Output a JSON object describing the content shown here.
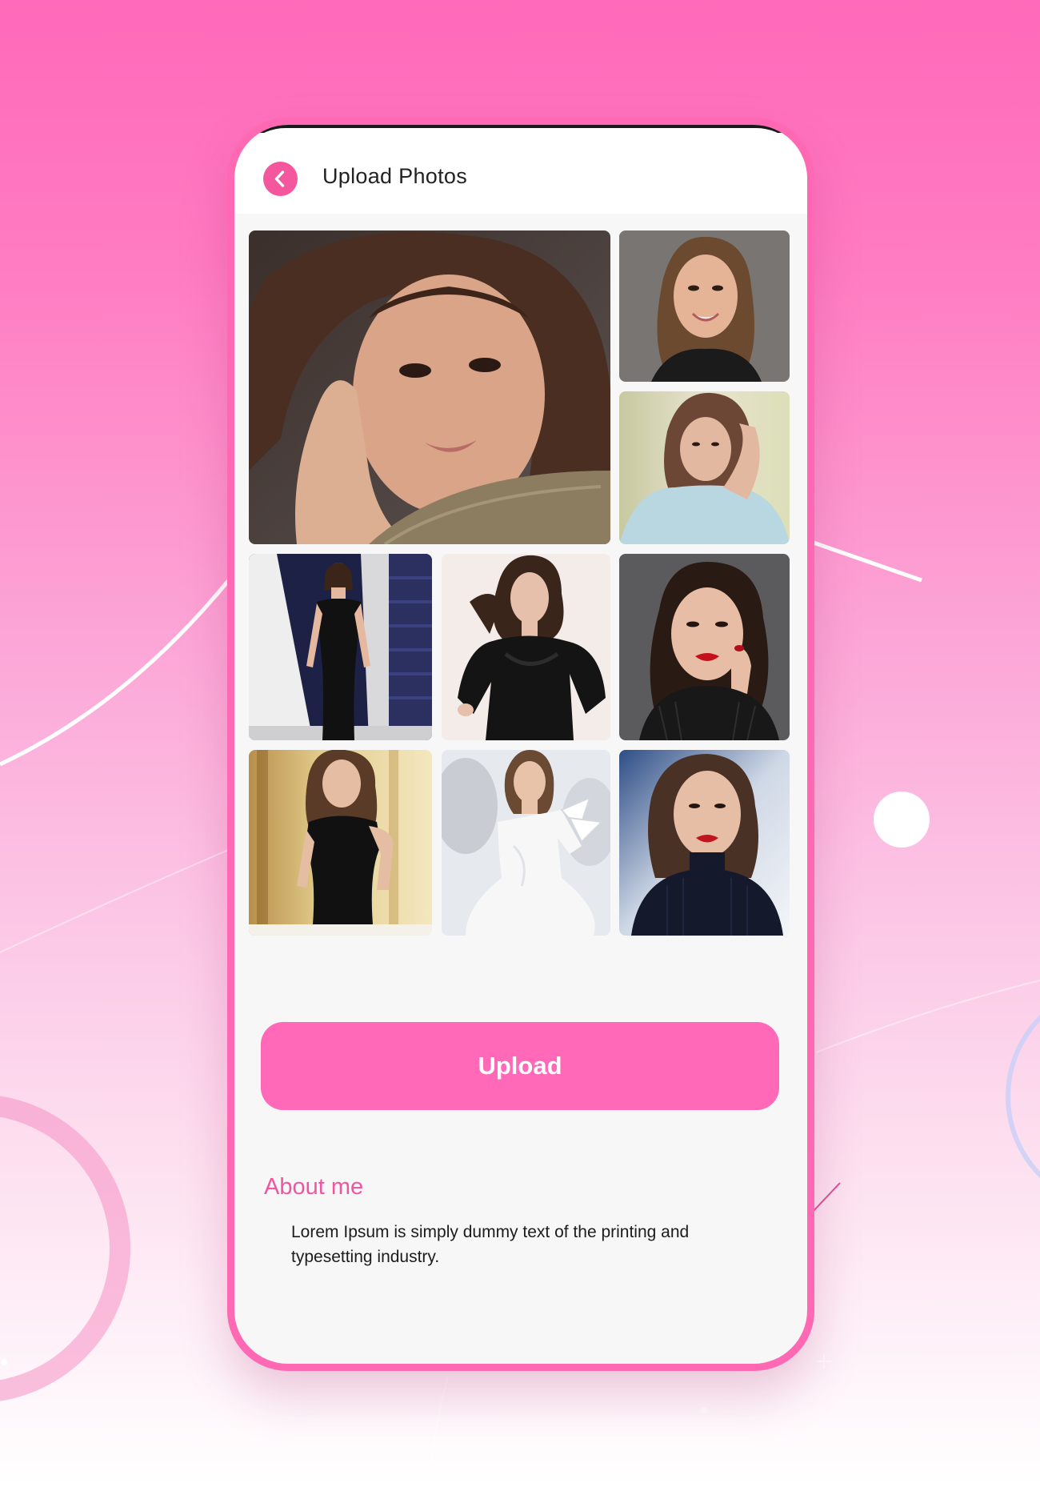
{
  "header": {
    "title": "Upload Photos"
  },
  "gallery": {
    "photos": [
      {
        "label": "Close-up portrait, hand on cheek"
      },
      {
        "label": "Smiling portrait"
      },
      {
        "label": "Seated portrait in light blouse"
      },
      {
        "label": "Black strapless outfit on red carpet"
      },
      {
        "label": "Black satin top"
      },
      {
        "label": "Portrait with red lipstick"
      },
      {
        "label": "Black dress"
      },
      {
        "label": "White sculptural gown"
      },
      {
        "label": "Black turtleneck portrait"
      }
    ]
  },
  "actions": {
    "upload_label": "Upload"
  },
  "about": {
    "title": "About me",
    "text": "Lorem Ipsum is simply dummy text of the printing and typesetting industry."
  },
  "colors": {
    "accent": "#ff69b8",
    "back_button": "#f5579f",
    "about_title": "#f2559f"
  },
  "icons": {
    "back": "chevron-left-icon"
  }
}
